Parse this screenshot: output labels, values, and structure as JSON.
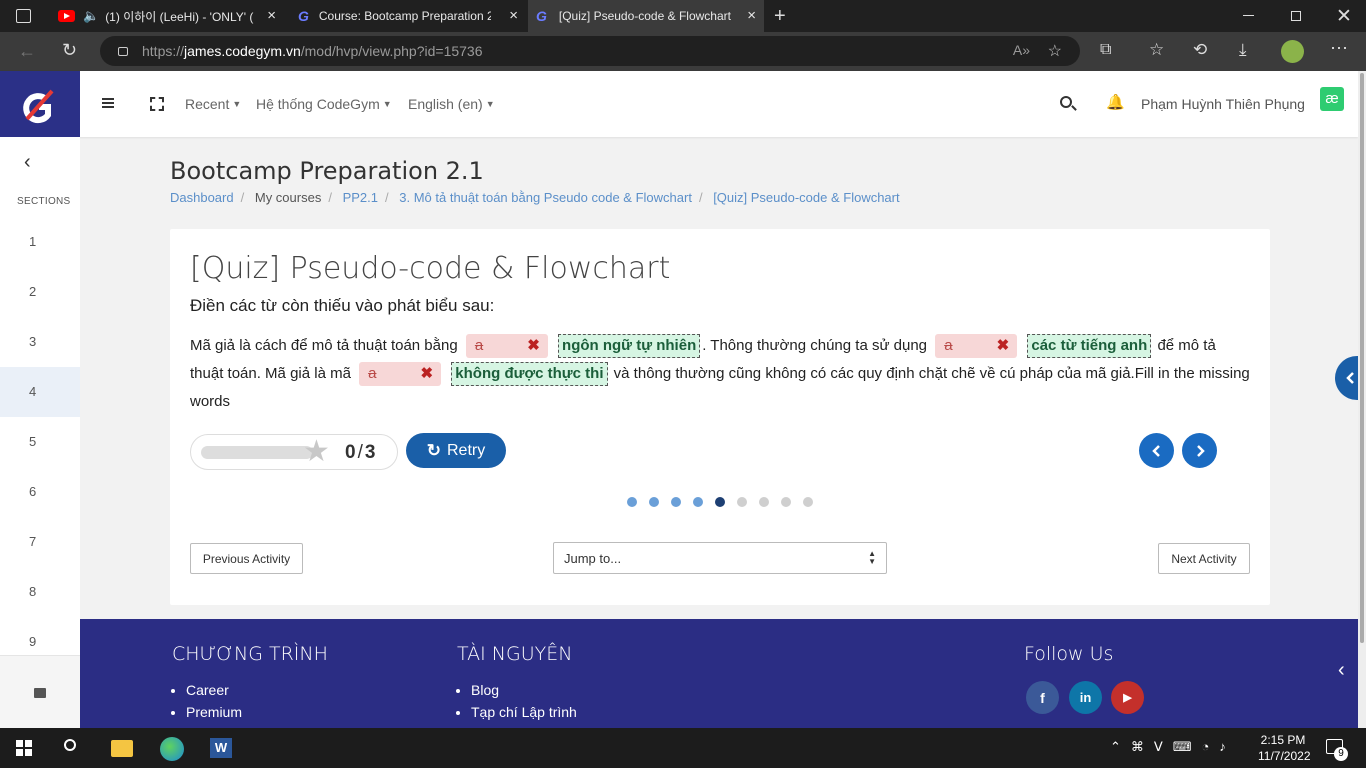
{
  "browser": {
    "tabs": [
      {
        "title": "(1) 이하이 (LeeHi) - 'ONLY' (",
        "icon": "youtube-icon"
      },
      {
        "title": "Course: Bootcamp Preparation 2.",
        "icon": "codegym-icon"
      },
      {
        "title": "[Quiz] Pseudo-code & Flowchart",
        "icon": "codegym-icon",
        "active": true
      }
    ],
    "url_prefix": "https://",
    "url_domain": "james.codegym.vn",
    "url_path": "/mod/hvp/view.php?id=15736"
  },
  "header": {
    "nav": [
      "Recent",
      "Hệ thống CodeGym",
      "English (en)"
    ],
    "user_name": "Phạm Huỳnh Thiên Phụng",
    "brand_color": "#2b3087"
  },
  "sidebar": {
    "sections_label": "SECTIONS",
    "items": [
      "1",
      "2",
      "3",
      "4",
      "5",
      "6",
      "7",
      "8",
      "9"
    ],
    "current": "4"
  },
  "page": {
    "title": "Bootcamp Preparation 2.1",
    "breadcrumbs": [
      "Dashboard",
      "My courses",
      "PP2.1",
      "3. Mô tả thuật toán bằng Pseudo code & Flowchart",
      "[Quiz] Pseudo-code & Flowchart"
    ]
  },
  "quiz": {
    "title": "[Quiz] Pseudo-code & Flowchart",
    "instruction": "Điền các từ còn thiếu vào phát biểu sau:",
    "text_1": "Mã giả là cách để mô tả thuật toán bằng",
    "wrong_1": "a",
    "correct_1": "ngôn ngữ tự nhiên",
    "text_2": ". Thông thường chúng ta sử dụng",
    "wrong_2": "a",
    "correct_2": "các từ tiếng anh",
    "text_3": "để mô tả thuật toán. Mã giả là mã",
    "wrong_3": "a",
    "correct_3": "không được thực thi",
    "text_4": "và thông thường cũng không có các quy định chặt chẽ về cú pháp của mã giả.Fill in the missing words",
    "score": "0",
    "score_sep": "/",
    "score_max": "3",
    "progress_fraction": 0,
    "retry_label": "Retry",
    "slides_total": 9,
    "slide_current": 5,
    "prev_activity": "Previous Activity",
    "jump_to": "Jump to...",
    "next_activity": "Next Activity"
  },
  "footer": {
    "col1_title": "CHƯƠNG TRÌNH",
    "col1_items": [
      "Career",
      "Premium"
    ],
    "col2_title": "TÀI NGUYÊN",
    "col2_items": [
      "Blog",
      "Tạp chí Lập trình"
    ],
    "follow_title": "Follow Us",
    "social": [
      "f",
      "in",
      "▶"
    ]
  },
  "taskbar": {
    "time": "2:15 PM",
    "date": "11/7/2022",
    "notification_count": "9"
  }
}
